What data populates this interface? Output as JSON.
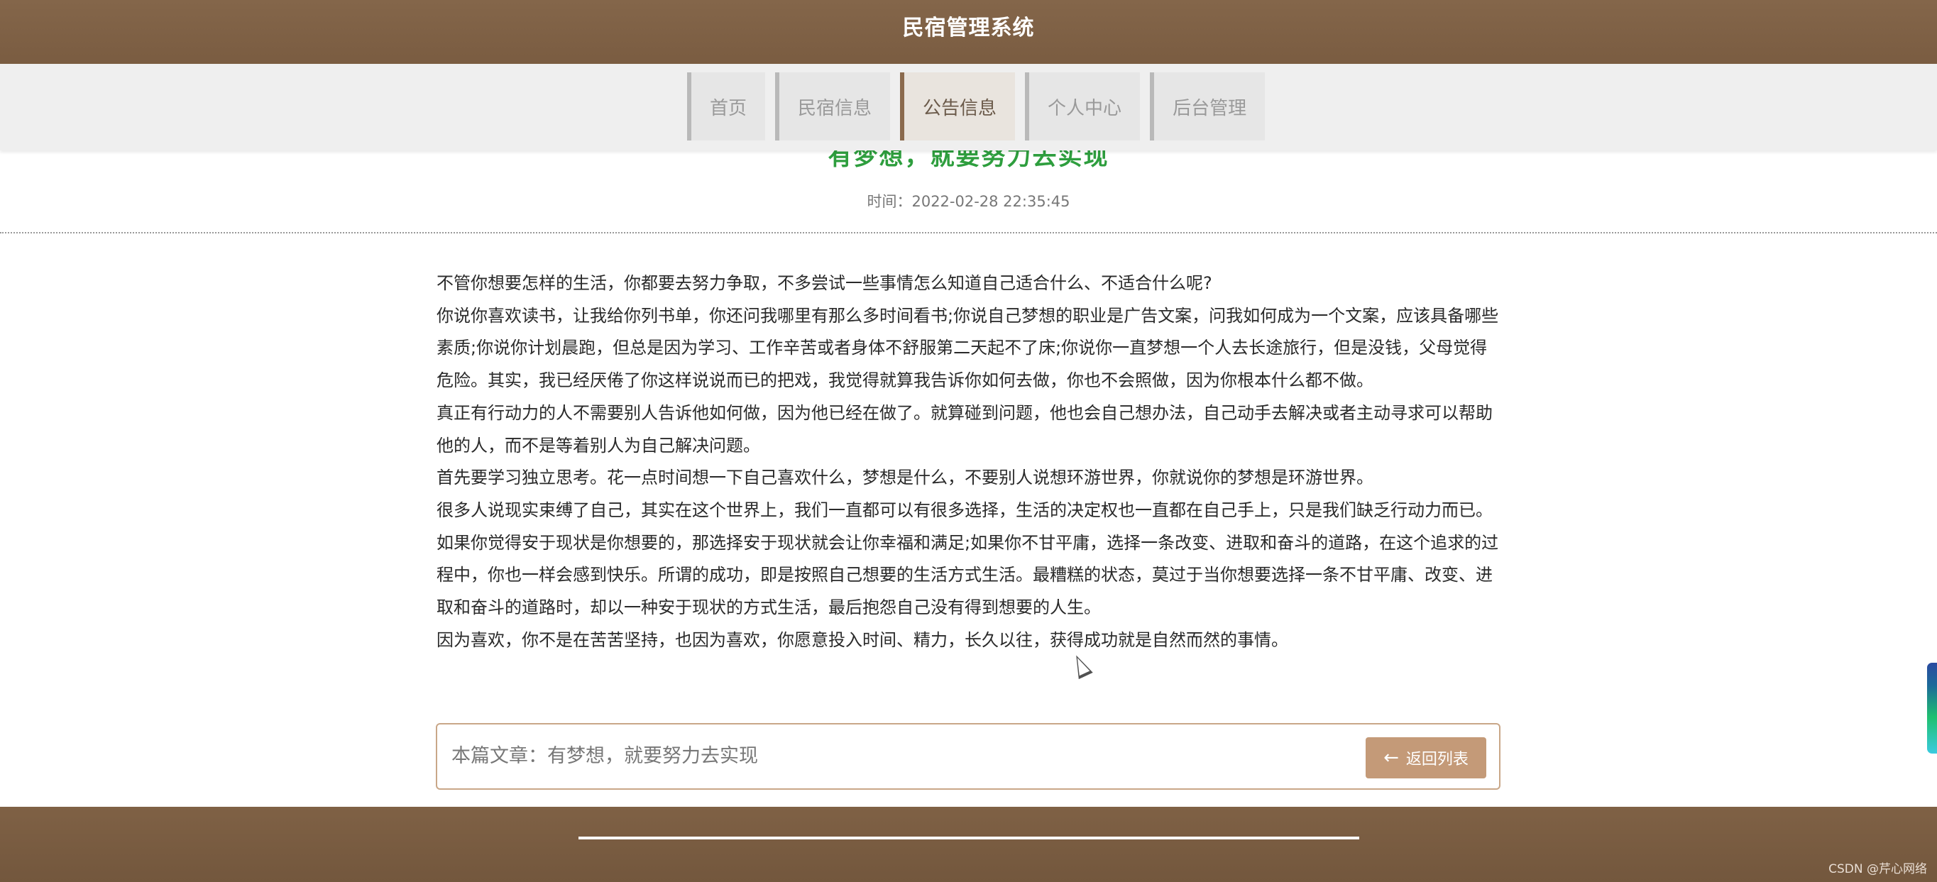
{
  "header": {
    "title": "民宿管理系统"
  },
  "nav": {
    "items": [
      {
        "label": "首页",
        "active": false
      },
      {
        "label": "民宿信息",
        "active": false
      },
      {
        "label": "公告信息",
        "active": true
      },
      {
        "label": "个人中心",
        "active": false
      },
      {
        "label": "后台管理",
        "active": false
      }
    ]
  },
  "article": {
    "title": "有梦想，就要努力去实现",
    "time": "时间：2022-02-28 22:35:45",
    "paragraphs": [
      "不管你想要怎样的生活，你都要去努力争取，不多尝试一些事情怎么知道自己适合什么、不适合什么呢?",
      "你说你喜欢读书，让我给你列书单，你还问我哪里有那么多时间看书;你说自己梦想的职业是广告文案，问我如何成为一个文案，应该具备哪些素质;你说你计划晨跑，但总是因为学习、工作辛苦或者身体不舒服第二天起不了床;你说你一直梦想一个人去长途旅行，但是没钱，父母觉得危险。其实，我已经厌倦了你这样说说而已的把戏，我觉得就算我告诉你如何去做，你也不会照做，因为你根本什么都不做。",
      "真正有行动力的人不需要别人告诉他如何做，因为他已经在做了。就算碰到问题，他也会自己想办法，自己动手去解决或者主动寻求可以帮助他的人，而不是等着别人为自己解决问题。",
      "首先要学习独立思考。花一点时间想一下自己喜欢什么，梦想是什么，不要别人说想环游世界，你就说你的梦想是环游世界。",
      "很多人说现实束缚了自己，其实在这个世界上，我们一直都可以有很多选择，生活的决定权也一直都在自己手上，只是我们缺乏行动力而已。",
      "如果你觉得安于现状是你想要的，那选择安于现状就会让你幸福和满足;如果你不甘平庸，选择一条改变、进取和奋斗的道路，在这个追求的过程中，你也一样会感到快乐。所谓的成功，即是按照自己想要的生活方式生活。最糟糕的状态，莫过于当你想要选择一条不甘平庸、改变、进取和奋斗的道路时，却以一种安于现状的方式生活，最后抱怨自己没有得到想要的人生。",
      "因为喜欢，你不是在苦苦坚持，也因为喜欢，你愿意投入时间、精力，长久以往，获得成功就是自然而然的事情。"
    ]
  },
  "footer_box": {
    "label": "本篇文章：有梦想，就要努力去实现",
    "back_button": "返回列表",
    "back_icon": "arrow-left-icon"
  },
  "watermark": "CSDN @芹心网络",
  "colors": {
    "brand_brown": "#7f6145",
    "title_green": "#2e9e3e",
    "button_tan": "#c49a78"
  }
}
